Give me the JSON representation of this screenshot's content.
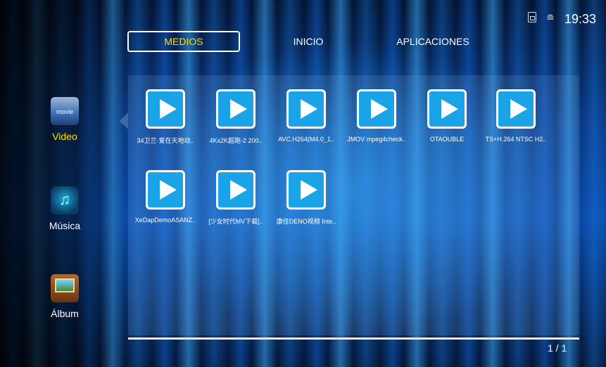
{
  "status_bar": {
    "sd_icon": "sd-card-icon",
    "wifi_icon": "wifi-icon",
    "time": "19:33"
  },
  "tabs": [
    {
      "label": "MEDIOS",
      "selected": true
    },
    {
      "label": "INICIO",
      "selected": false
    },
    {
      "label": "APLICACIONES",
      "selected": false
    }
  ],
  "sidebar": {
    "items": [
      {
        "label": "Video",
        "icon": "video-icon",
        "icon_text": "movie",
        "selected": true
      },
      {
        "label": "Música",
        "icon": "music-icon",
        "icon_text": "♫",
        "selected": false
      },
      {
        "label": "Álbum",
        "icon": "album-icon",
        "icon_text": "",
        "selected": false
      }
    ]
  },
  "files": [
    {
      "name": "34卫兰·爱在天地动.."
    },
    {
      "name": "4Kx2K超跑-2  200.."
    },
    {
      "name": "AVC.H264(M4.0_1.."
    },
    {
      "name": "JMOV mpeg4check.."
    },
    {
      "name": "OTAOUBLE"
    },
    {
      "name": "TS+H.264 NTSC H2.."
    },
    {
      "name": "XeDapDemoASANZ.."
    },
    {
      "name": "[少女时代MV下载].."
    },
    {
      "name": "康佳DENO视频 Inte.."
    }
  ],
  "pagination": "1 / 1",
  "colors": {
    "accent": "#ffe000",
    "play_tile": "#1aa3e6"
  }
}
